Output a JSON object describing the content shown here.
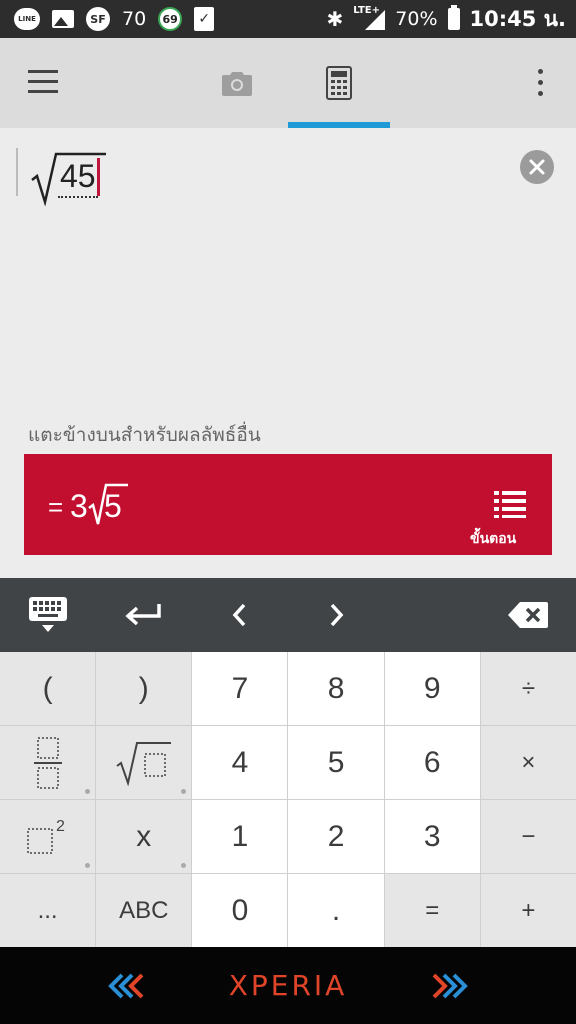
{
  "status_bar": {
    "line_label": "LINE",
    "sf_label": "SF",
    "notif_count": "70",
    "badge_69": "69",
    "lte_label": "LTE+",
    "battery": "70%",
    "time": "10:45 น."
  },
  "input": {
    "expression": "45"
  },
  "hint": "แตะข้างบนสำหรับผลลัพธ์อื่น",
  "result": {
    "equals": "=",
    "coefficient": "3",
    "radicand": "5",
    "steps_label": "ขั้นตอน",
    "color": "#c20f30"
  },
  "keypad": {
    "keys": [
      {
        "label": "(",
        "name": "key-open-paren"
      },
      {
        "label": ")",
        "name": "key-close-paren"
      },
      {
        "label": "7",
        "name": "key-7"
      },
      {
        "label": "8",
        "name": "key-8"
      },
      {
        "label": "9",
        "name": "key-9"
      },
      {
        "label": "÷",
        "name": "key-divide"
      },
      {
        "label": "4",
        "name": "key-4"
      },
      {
        "label": "5",
        "name": "key-5"
      },
      {
        "label": "6",
        "name": "key-6"
      },
      {
        "label": "×",
        "name": "key-multiply"
      },
      {
        "label": "x",
        "name": "key-x"
      },
      {
        "label": "1",
        "name": "key-1"
      },
      {
        "label": "2",
        "name": "key-2"
      },
      {
        "label": "3",
        "name": "key-3"
      },
      {
        "label": "−",
        "name": "key-minus"
      },
      {
        "label": "...",
        "name": "key-more"
      },
      {
        "label": "ABC",
        "name": "key-abc"
      },
      {
        "label": "0",
        "name": "key-0"
      },
      {
        "label": ".",
        "name": "key-decimal"
      },
      {
        "label": "=",
        "name": "key-equals"
      },
      {
        "label": "+",
        "name": "key-plus"
      }
    ]
  },
  "brand": "XPERIA",
  "colors": {
    "accent_tab": "#1e9bd7",
    "brand": "#e0452a"
  }
}
